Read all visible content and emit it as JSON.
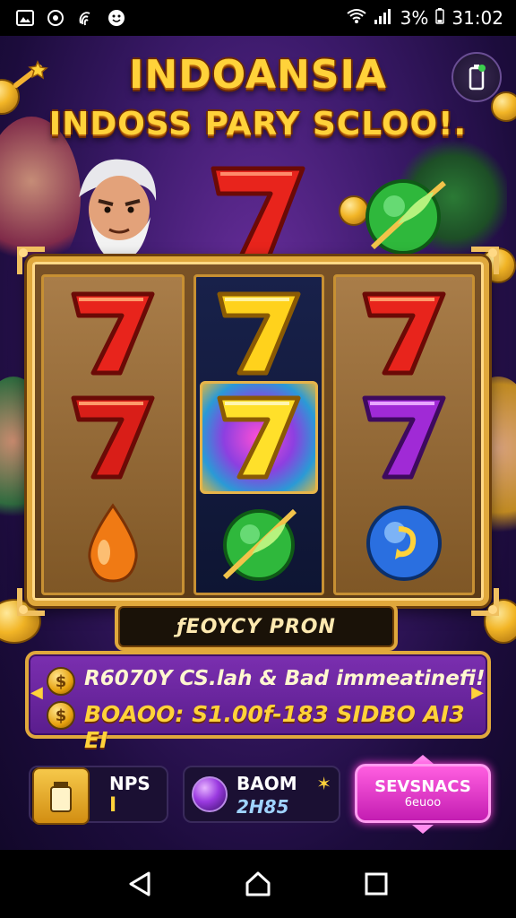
{
  "status_bar": {
    "battery": "3%",
    "time": "31:02",
    "icons": [
      "gallery-icon",
      "circle-icon",
      "fingerprint-icon",
      "emoji-icon",
      "wifi-icon",
      "signal-icon",
      "battery-icon"
    ]
  },
  "game": {
    "title_line_1": "INDOANSIA",
    "title_line_2": "INDOSS PARY SCLOO!.",
    "reels": [
      [
        "seven-red",
        "seven-red",
        "drop-orange"
      ],
      [
        "seven-gold",
        "seven-gold-highlight",
        "leaf-green"
      ],
      [
        "seven-red",
        "seven-purple",
        "orb-blue"
      ]
    ],
    "banner_text": "ƒEOYCY PRON",
    "info": {
      "line_1": "R6070Y CS.lah & Bad immeatinefi!",
      "line_2": "BOAOO: S1.00f-183 SIDBO AI3 EI"
    },
    "bottom": {
      "box_1_label": "NPS",
      "box_1_value": "I",
      "box_2_label": "BAOM",
      "box_2_value": "2H85",
      "spin_label": "SEVSNACS",
      "spin_sub": "6euoo"
    },
    "colors": {
      "gold": "#ffd23a",
      "purple": "#5a1d8d",
      "magenta": "#ff5ee0"
    }
  },
  "nav_bar": {
    "icons": [
      "back-icon",
      "home-icon",
      "recents-icon"
    ]
  }
}
